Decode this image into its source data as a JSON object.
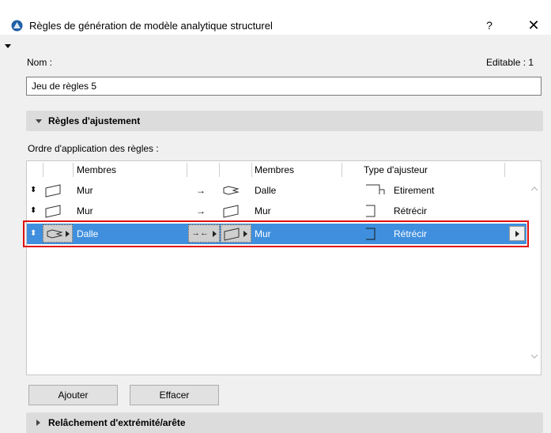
{
  "window": {
    "title": "Règles de génération de modèle analytique structurel",
    "help": "?",
    "close": "✕"
  },
  "name_field": {
    "label": "Nom :",
    "value": "Jeu de règles 5",
    "editable": "Editable : 1"
  },
  "adjust_section": {
    "label": "Règles d'ajustement"
  },
  "order_label": "Ordre d'application des règles :",
  "table": {
    "headers": {
      "members_1": "Membres",
      "members_2": "Membres",
      "adjuster_type": "Type d'ajusteur"
    },
    "rows": [
      {
        "member1": "Mur",
        "arrow": "→",
        "member2": "Dalle",
        "adjuster": "Etirement",
        "selected": false
      },
      {
        "member1": "Mur",
        "arrow": "→",
        "member2": "Mur",
        "adjuster": "Rétrécir",
        "selected": false
      },
      {
        "member1": "Dalle",
        "arrow": "→←",
        "member2": "Mur",
        "adjuster": "Rétrécir",
        "selected": true
      }
    ]
  },
  "buttons": {
    "add": "Ajouter",
    "delete": "Effacer"
  },
  "release_section": {
    "label": "Relâchement d'extrémité/arête"
  },
  "colors": {
    "selection": "#3f8fde",
    "highlight_border": "#e01010"
  }
}
